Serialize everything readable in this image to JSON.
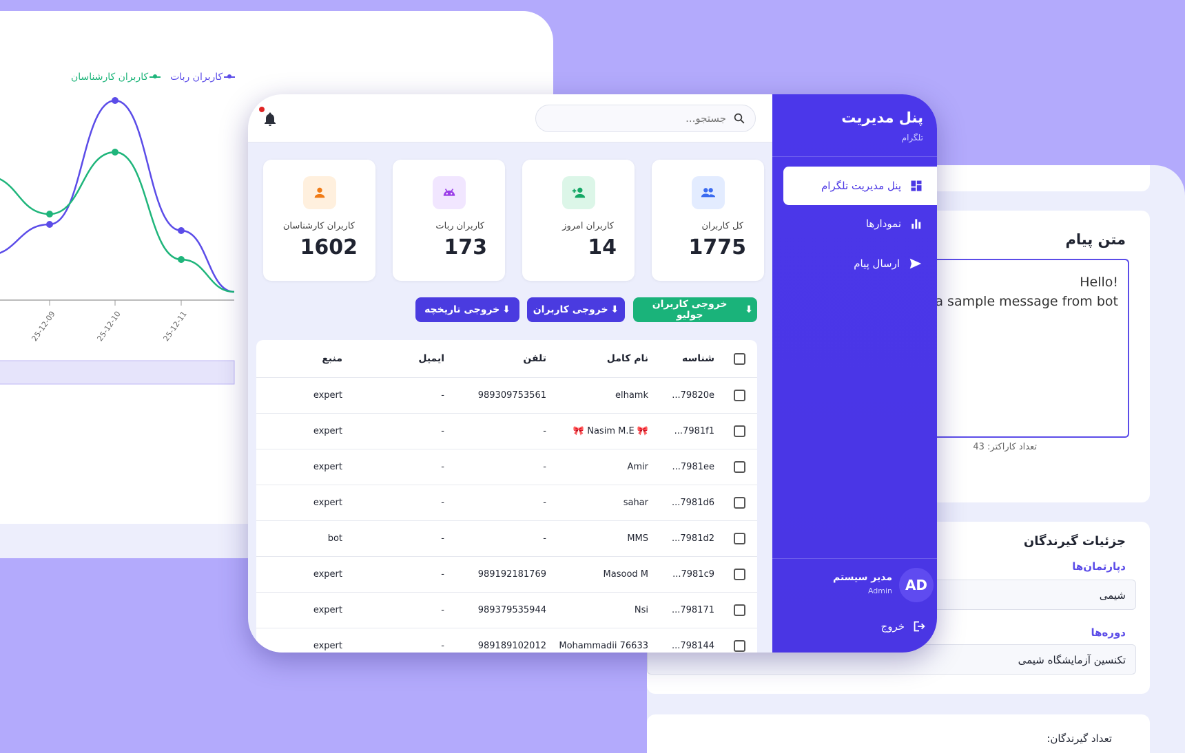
{
  "chart": {
    "legend": [
      {
        "label": "کاربران ربات",
        "color": "#5b4ce8"
      },
      {
        "label": "کاربران کارشناسان",
        "color": "#1fb57b"
      }
    ]
  },
  "chart_data": {
    "type": "line",
    "title": "",
    "xlabel": "",
    "ylabel": "",
    "categories": [
      "25-12-09",
      "25-12-10",
      "25-12-11"
    ],
    "series": [
      {
        "name": "کاربران ربات",
        "color": "#5b4ce8",
        "values": [
          1,
          7,
          0.7
        ]
      },
      {
        "name": "کاربران کارشناسان",
        "color": "#1fb57b",
        "values": [
          1.5,
          4.5,
          -0.7
        ]
      }
    ]
  },
  "message": {
    "title": "متن پیام",
    "text_line1": "Hello!",
    "text_line2": "is a sample message from bot",
    "char_count": "تعداد کاراکتر: 43"
  },
  "recipients": {
    "title": "جزئیات گیرندگان",
    "departments_label": "دپارتمان‌ها",
    "department_value": "شیمی",
    "courses_label": "دوره‌ها",
    "course_value": "تکنسین آزمایشگاه شیمی",
    "count_label": "تعداد گیرندگان:"
  },
  "search": {
    "placeholder": "جستجو..."
  },
  "stats": [
    {
      "label": "کل کاربران",
      "value": "1775",
      "icon": "users-icon",
      "bg": "#e3ecff",
      "fg": "#3b6bf0"
    },
    {
      "label": "کاربران امروز",
      "value": "14",
      "icon": "user-plus-icon",
      "bg": "#dcf6e8",
      "fg": "#15a866"
    },
    {
      "label": "کاربران ربات",
      "value": "173",
      "icon": "android-icon",
      "bg": "#f1e6ff",
      "fg": "#9b3fe8"
    },
    {
      "label": "کاربران کارشناسان",
      "value": "1602",
      "icon": "person-icon",
      "bg": "#fff0de",
      "fg": "#f07b16"
    }
  ],
  "buttons": {
    "export_july": "خروجی کاربران جولیو",
    "export_users": "خروجی کاربران",
    "export_history": "خروجی تاریخچه"
  },
  "table": {
    "headers": {
      "id": "شناسه",
      "name": "نام کامل",
      "phone": "تلفن",
      "email": "ایمیل",
      "source": "منبع"
    },
    "rows": [
      {
        "id": "...79820e",
        "name": "elhamk",
        "phone": "989309753561",
        "email": "-",
        "source": "expert"
      },
      {
        "id": "...7981f1",
        "name": "🎀 Nasim M.E 🎀",
        "phone": "-",
        "email": "-",
        "source": "expert"
      },
      {
        "id": "...7981ee",
        "name": "Amir",
        "phone": "-",
        "email": "-",
        "source": "expert"
      },
      {
        "id": "...7981d6",
        "name": "sahar",
        "phone": "-",
        "email": "-",
        "source": "expert"
      },
      {
        "id": "...7981d2",
        "name": "MMS",
        "phone": "-",
        "email": "-",
        "source": "bot"
      },
      {
        "id": "...7981c9",
        "name": "Masood M",
        "phone": "989192181769",
        "email": "-",
        "source": "expert"
      },
      {
        "id": "...798171",
        "name": "Nsi",
        "phone": "989379535944",
        "email": "-",
        "source": "expert"
      },
      {
        "id": "...798144",
        "name": "Mohammadii 76633",
        "phone": "989189102012",
        "email": "-",
        "source": "expert"
      }
    ]
  },
  "sidebar": {
    "title": "پنل مدیریت",
    "subtitle": "تلگرام",
    "items": [
      {
        "label": "پنل مدیریت تلگرام",
        "icon": "dashboard-icon"
      },
      {
        "label": "نمودارها",
        "icon": "bar-chart-icon"
      },
      {
        "label": "ارسال پیام",
        "icon": "send-icon"
      }
    ],
    "user_initials": "AD",
    "user_name": "مدیر سیستم",
    "user_role": "Admin",
    "logout": "خروج"
  }
}
